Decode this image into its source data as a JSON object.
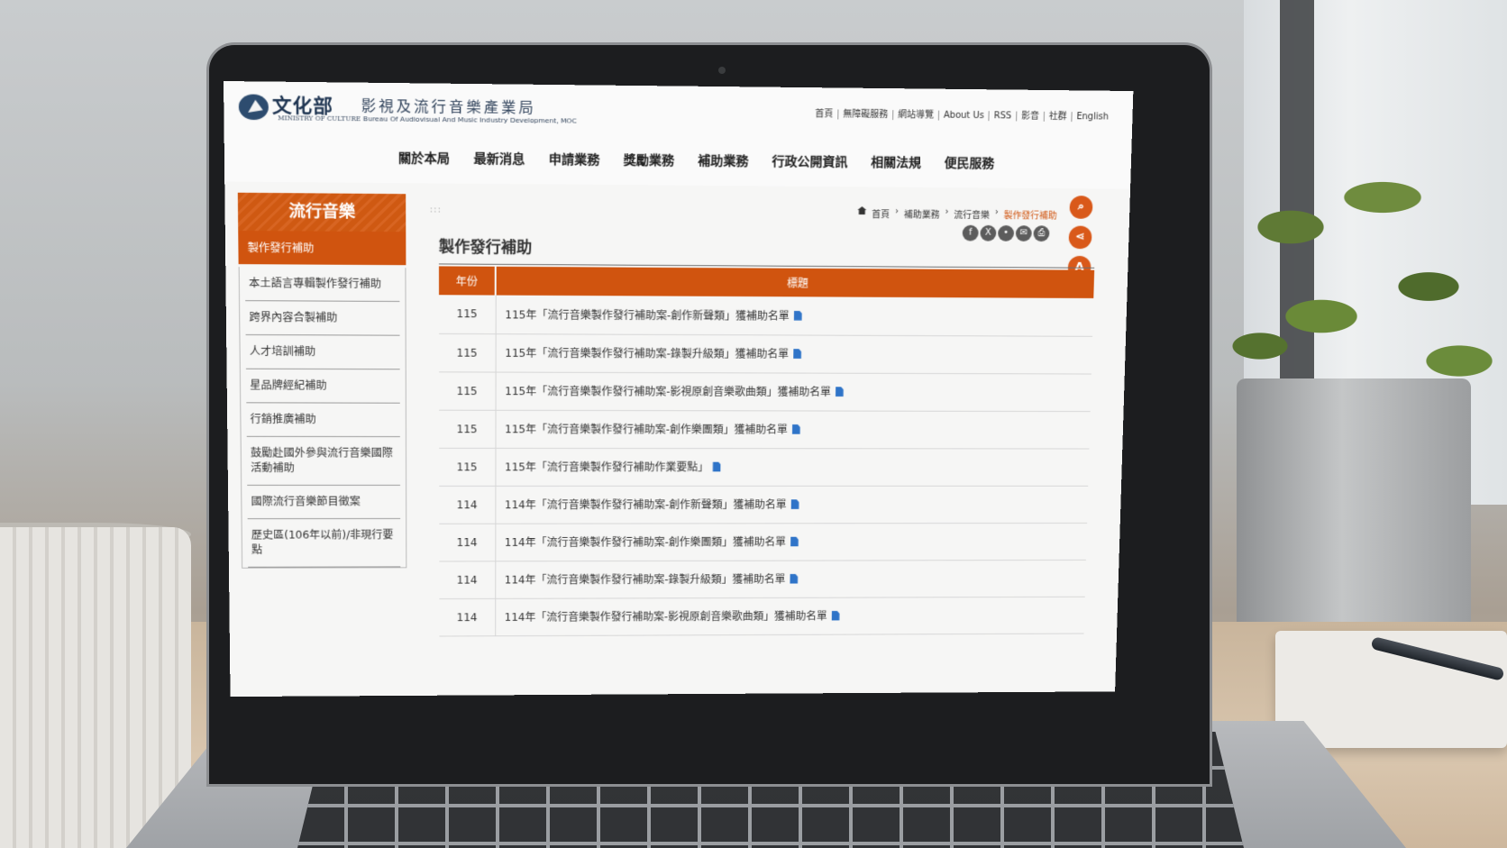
{
  "header": {
    "ministry_name": "文化部",
    "ministry_en": "MINISTRY OF CULTURE",
    "bureau_name": "影視及流行音樂產業局",
    "bureau_en": "Bureau Of Audiovisual And Music Industry Development, MOC",
    "top_links": [
      "首頁",
      "無障礙服務",
      "網站導覽",
      "About Us",
      "RSS",
      "影音",
      "社群",
      "English"
    ]
  },
  "nav": [
    "關於本局",
    "最新消息",
    "申請業務",
    "獎勵業務",
    "補助業務",
    "行政公開資訊",
    "相關法規",
    "便民服務"
  ],
  "sidebar": {
    "title": "流行音樂",
    "active": "製作發行補助",
    "items": [
      "本土語言專輯製作發行補助",
      "跨界內容合製補助",
      "人才培訓補助",
      "星品牌經紀補助",
      "行銷推廣補助",
      "鼓勵赴國外參與流行音樂國際活動補助",
      "國際流行音樂節目徵案",
      "歷史區(106年以前)/非現行要點"
    ]
  },
  "breadcrumb": [
    "首頁",
    "補助業務",
    "流行音樂",
    "製作發行補助"
  ],
  "share_icons": [
    "facebook-icon",
    "x-icon",
    "line-icon",
    "email-icon",
    "print-icon"
  ],
  "tools": {
    "search": "search-icon",
    "share": "share-icon",
    "font": "A"
  },
  "page_title": "製作發行補助",
  "table": {
    "headers": {
      "year": "年份",
      "title": "標題"
    },
    "rows": [
      {
        "year": "115",
        "title": "115年「流行音樂製作發行補助案-創作新聲類」獲補助名單"
      },
      {
        "year": "115",
        "title": "115年「流行音樂製作發行補助案-錄製升級類」獲補助名單"
      },
      {
        "year": "115",
        "title": "115年「流行音樂製作發行補助案-影視原創音樂歌曲類」獲補助名單"
      },
      {
        "year": "115",
        "title": "115年「流行音樂製作發行補助案-創作樂團類」獲補助名單"
      },
      {
        "year": "115",
        "title": "115年「流行音樂製作發行補助作業要點」"
      },
      {
        "year": "114",
        "title": "114年「流行音樂製作發行補助案-創作新聲類」獲補助名單"
      },
      {
        "year": "114",
        "title": "114年「流行音樂製作發行補助案-創作樂團類」獲補助名單"
      },
      {
        "year": "114",
        "title": "114年「流行音樂製作發行補助案-錄製升級類」獲補助名單"
      },
      {
        "year": "114",
        "title": "114年「流行音樂製作發行補助案-影視原創音樂歌曲類」獲補助名單"
      }
    ]
  }
}
